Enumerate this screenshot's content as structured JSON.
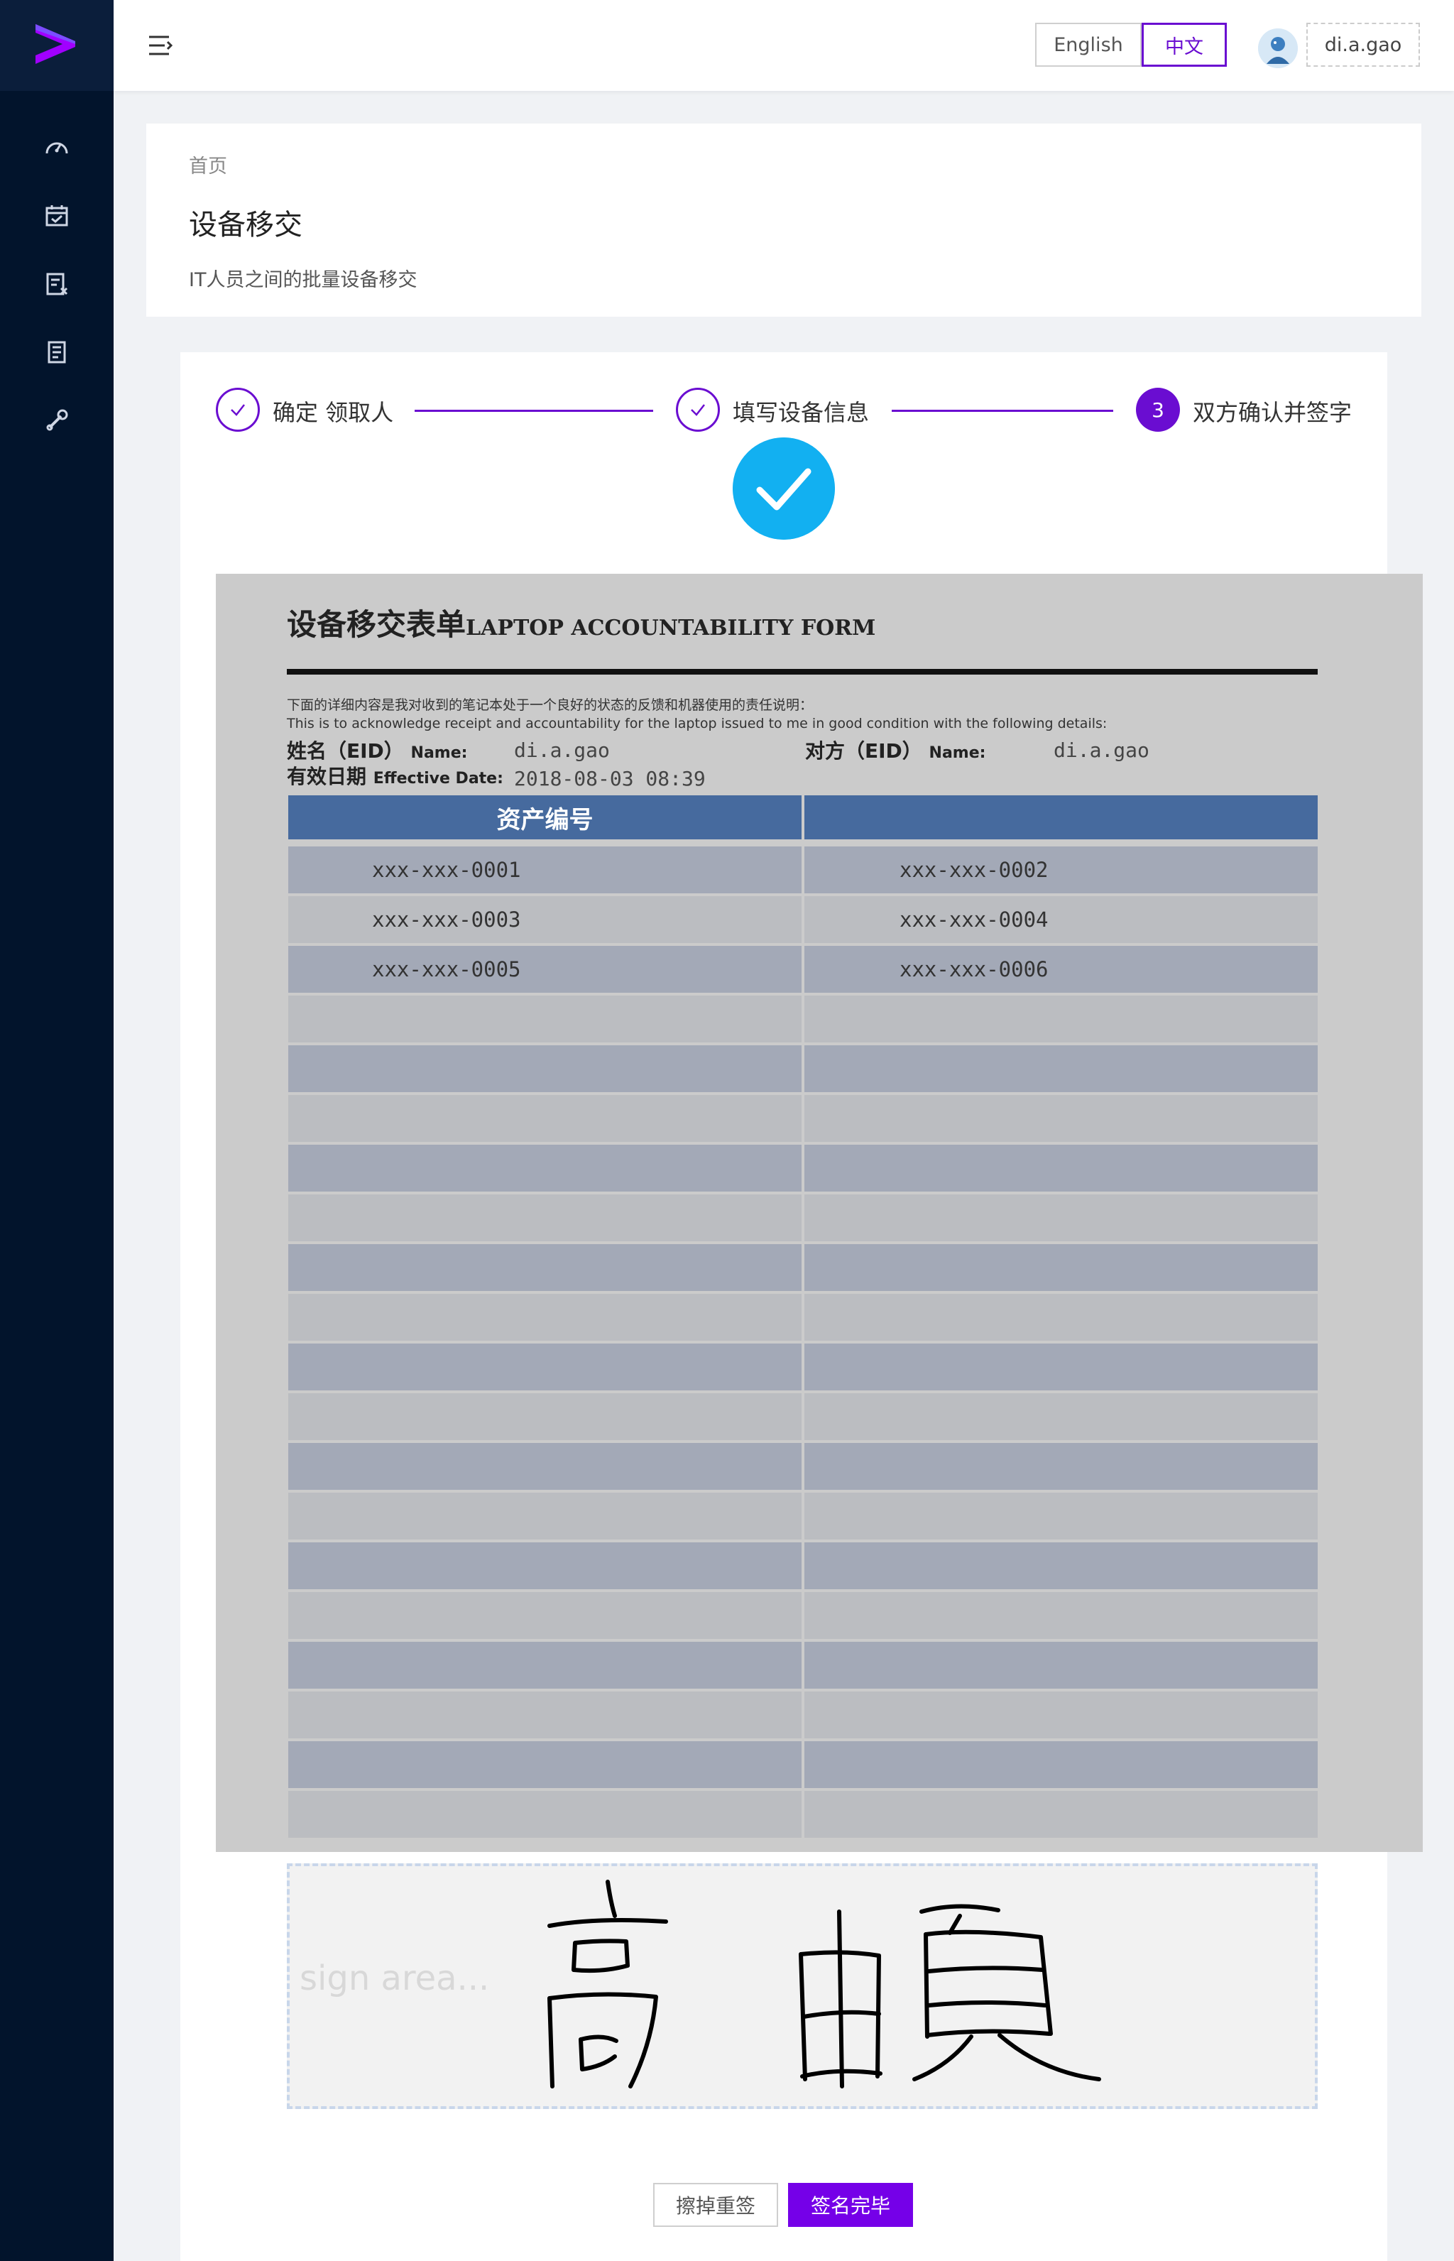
{
  "header": {
    "lang_en": "English",
    "lang_zh": "中文",
    "user": "di.a.gao"
  },
  "sidebar": {
    "icons": [
      "dashboard-icon",
      "calendar-icon",
      "checklist-icon",
      "document-icon",
      "wrench-icon"
    ]
  },
  "page": {
    "breadcrumb": "首页",
    "title": "设备移交",
    "description": "IT人员之间的批量设备移交"
  },
  "steps": [
    {
      "label": "确定 领取人",
      "status": "done"
    },
    {
      "label": "填写设备信息",
      "status": "done"
    },
    {
      "number": "3",
      "label": "双方确认并签字",
      "status": "active"
    }
  ],
  "form": {
    "title_cn": "设备移交表单",
    "title_en": "LAPTOP ACCOUNTABILITY FORM",
    "note_cn": "下面的详细内容是我对收到的笔记本处于一个良好的状态的反馈和机器使用的责任说明：",
    "note_en": "This is to acknowledge receipt and accountability for the laptop issued to me in good condition with the following details:",
    "name_label_cn": "姓名（EID）",
    "name_label_en": "Name:",
    "name_value": "di.a.gao",
    "counter_label_cn": "对方（EID）",
    "counter_label_en": "Name:",
    "counter_value": "di.a.gao",
    "date_label_cn": "有效日期",
    "date_label_en": "Effective Date:",
    "date_value": "2018-08-03 08:39",
    "table_header_left": "资产编号",
    "table_header_right": "",
    "assets": [
      [
        "xxx-xxx-0001",
        "xxx-xxx-0002"
      ],
      [
        "xxx-xxx-0003",
        "xxx-xxx-0004"
      ],
      [
        "xxx-xxx-0005",
        "xxx-xxx-0006"
      ]
    ]
  },
  "sign": {
    "placeholder": "sign area..."
  },
  "buttons": {
    "clear": "擦掉重签",
    "done": "签名完毕"
  },
  "colors": {
    "accent": "#6a0dd1",
    "primary_button": "#7500e8",
    "sidebar_bg": "#02142c",
    "success": "#12b0f1",
    "table_header": "#466a9e"
  }
}
